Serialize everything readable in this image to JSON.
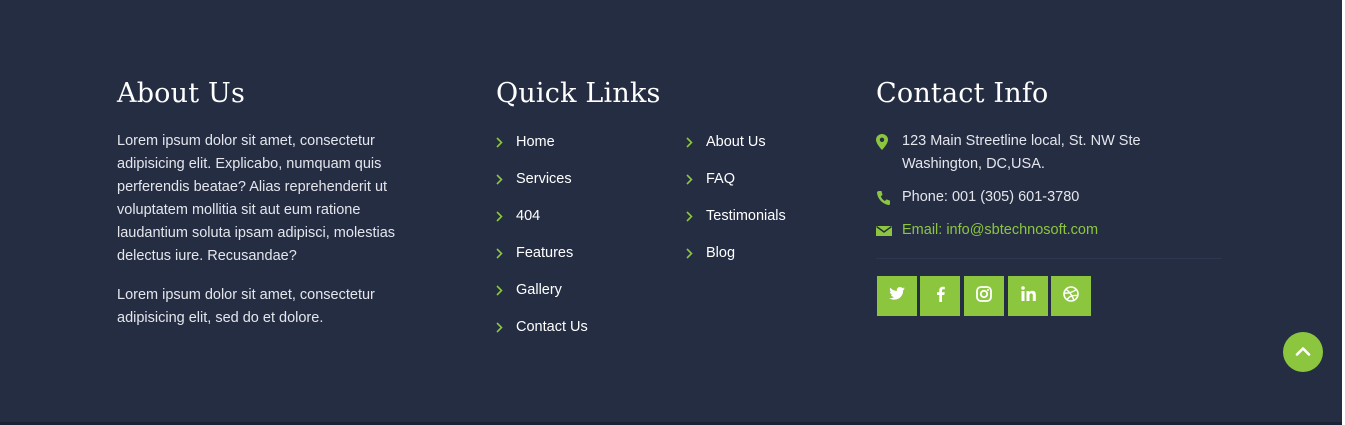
{
  "colors": {
    "background": "#252d43",
    "accent": "#8cc63f",
    "text": "#e4e6ec"
  },
  "about": {
    "title": "About Us",
    "paragraphs": [
      "Lorem ipsum dolor sit amet, consectetur adipisicing elit. Explicabo, numquam quis perferendis beatae? Alias reprehenderit ut voluptatem mollitia sit aut eum ratione laudantium soluta ipsam adipisci, molestias delectus iure. Recusandae?",
      "Lorem ipsum dolor sit amet, consectetur adipisicing elit, sed do et dolore."
    ]
  },
  "quick_links": {
    "title": "Quick Links",
    "column_1": [
      "Home",
      "Services",
      "404",
      "Features",
      "Gallery",
      "Contact Us"
    ],
    "column_2": [
      "About Us",
      "FAQ",
      "Testimonials",
      "Blog"
    ],
    "icon": "chevron-right-icon"
  },
  "contact": {
    "title": "Contact Info",
    "address_line_1": "123 Main Streetline local, St. NW Ste",
    "address_line_2": "Washington, DC,USA.",
    "phone": "Phone: 001 (305) 601-3780",
    "email": "Email: info@sbtechnosoft.com",
    "icons": [
      "map-pin-icon",
      "phone-icon",
      "envelope-icon"
    ]
  },
  "social": [
    {
      "name": "twitter",
      "icon": "twitter-icon"
    },
    {
      "name": "facebook",
      "icon": "facebook-icon"
    },
    {
      "name": "instagram",
      "icon": "instagram-icon"
    },
    {
      "name": "linkedin",
      "icon": "linkedin-icon"
    },
    {
      "name": "dribbble",
      "icon": "dribbble-icon"
    }
  ],
  "back_to_top": {
    "icon": "chevron-up-icon"
  }
}
